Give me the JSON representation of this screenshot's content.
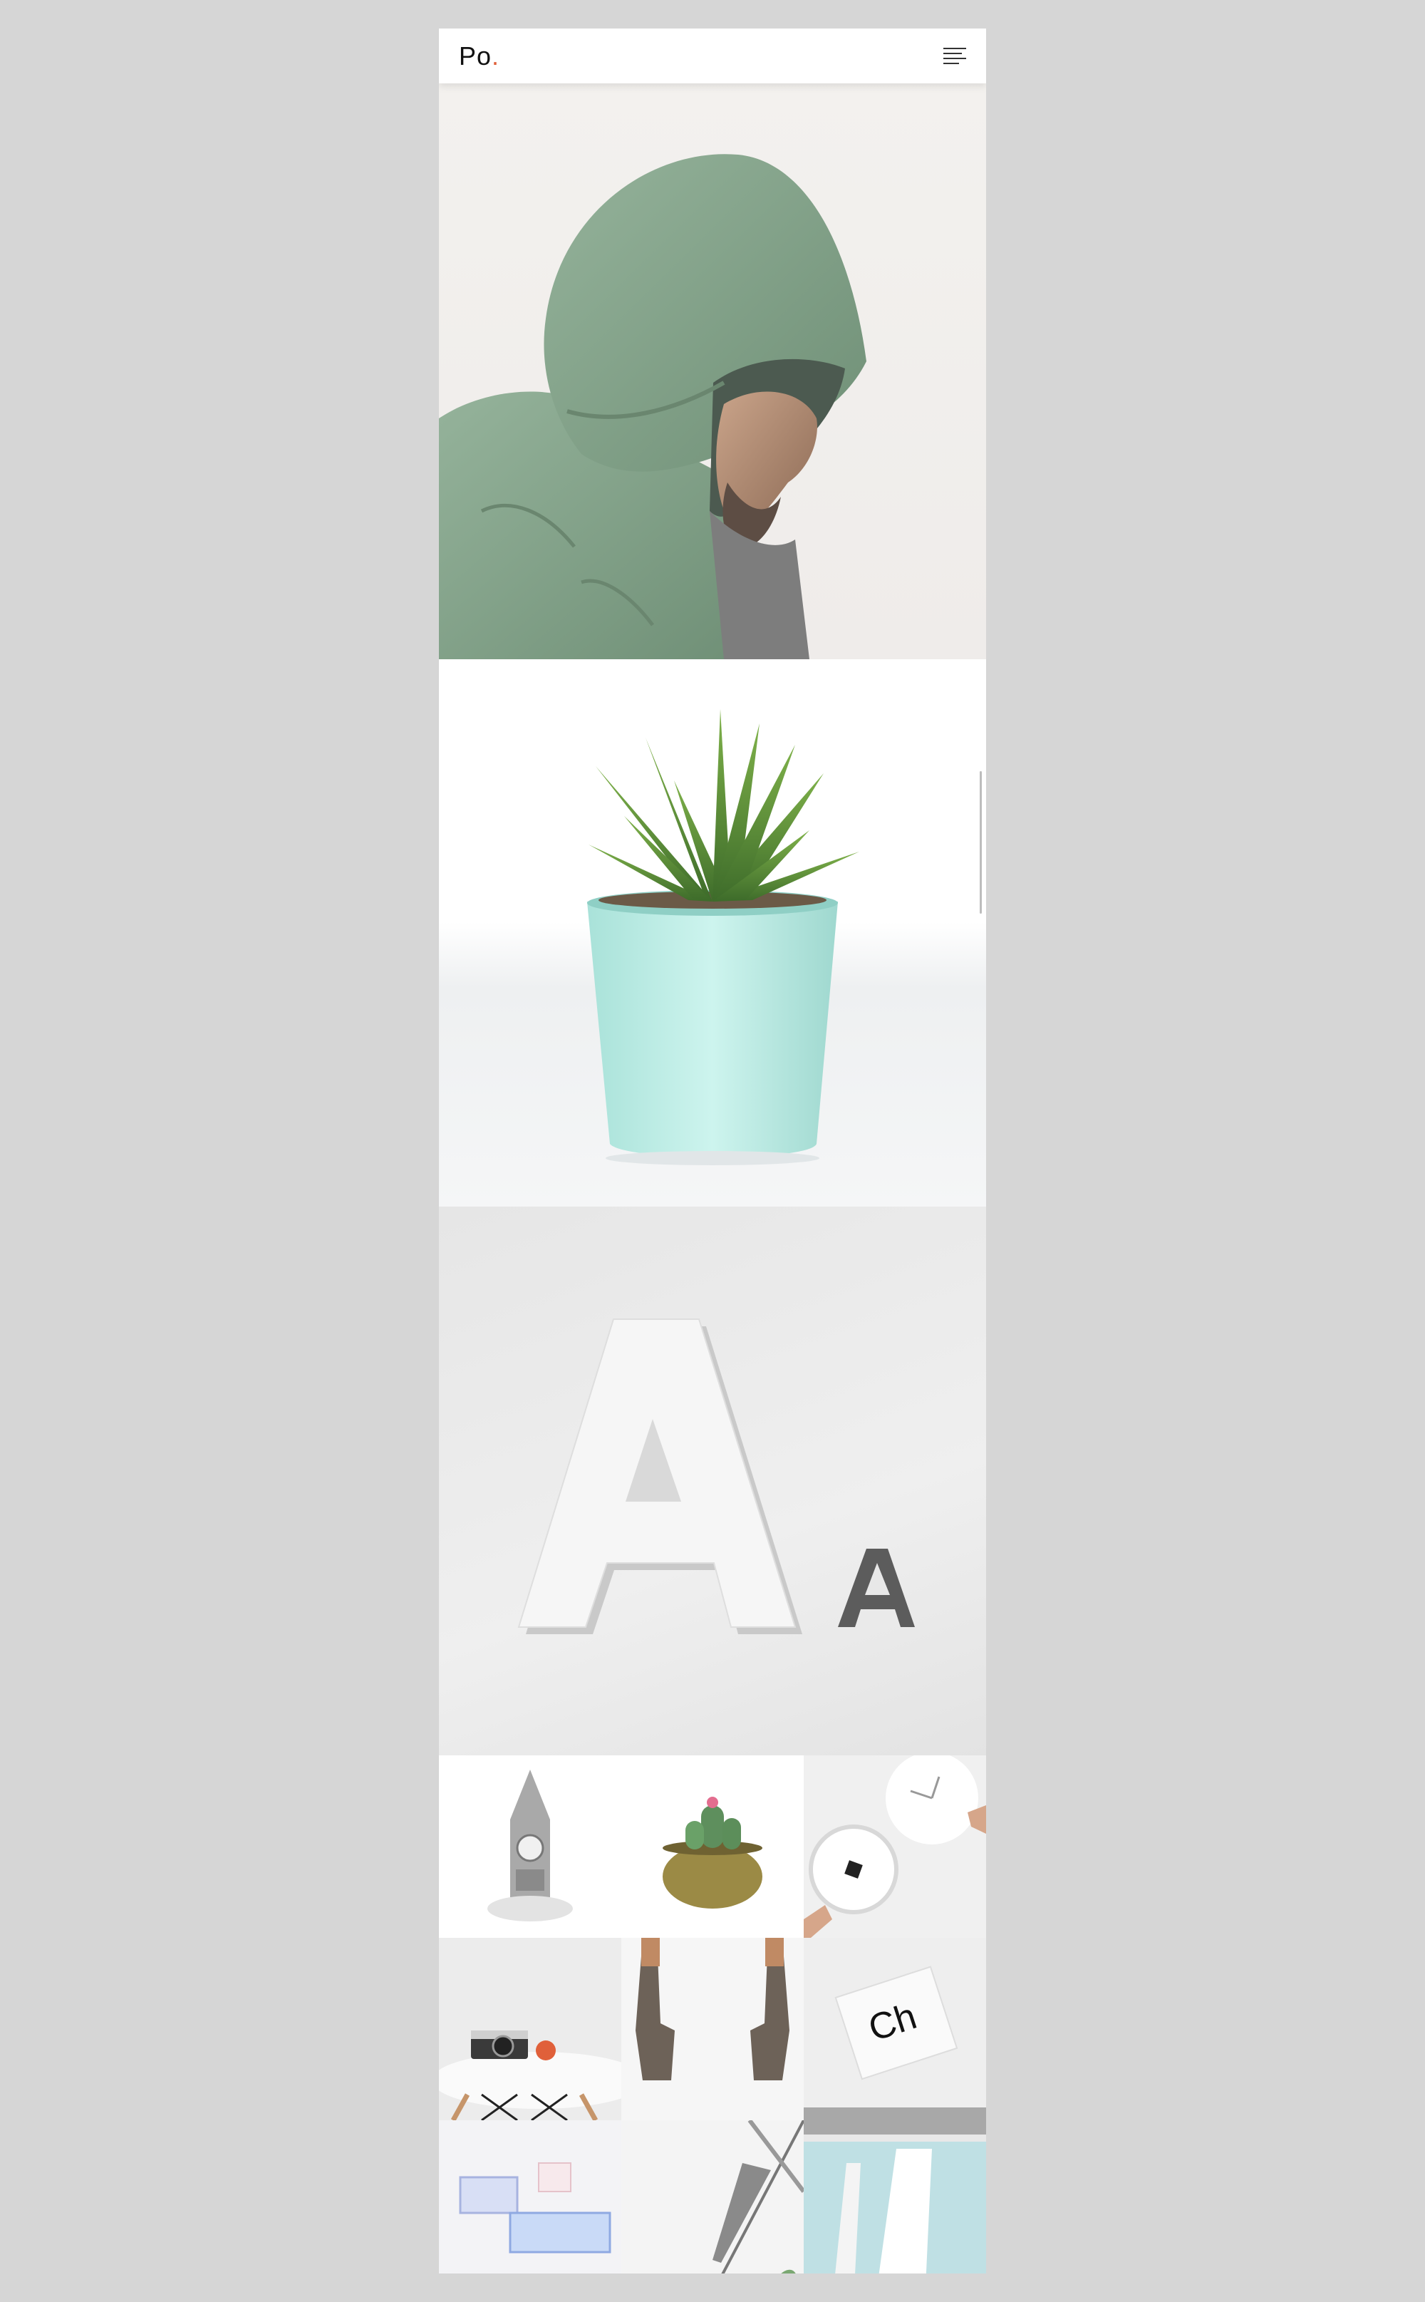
{
  "header": {
    "logo_text": "Po",
    "logo_dot": ".",
    "menu_icon": "hamburger-menu-icon"
  },
  "gallery": {
    "hero_images": [
      "hooded-man-photo",
      "succulent-pot-photo",
      "letter-a-sculpture-photo"
    ],
    "thumbnails": [
      "clock-tower-photo",
      "cactus-brass-pot-photo",
      "wall-clock-hands-photo",
      "camera-on-chair-photo",
      "bronze-hands-photo",
      "ch-paper-card-photo",
      "glass-boxes-photo",
      "pen-on-desk-photo",
      "architecture-photo"
    ],
    "letter_large": "A",
    "letter_small": "A",
    "card_text": "Ch"
  },
  "colors": {
    "page_background": "#d6d6d6",
    "accent_dot": "#e0603a"
  }
}
